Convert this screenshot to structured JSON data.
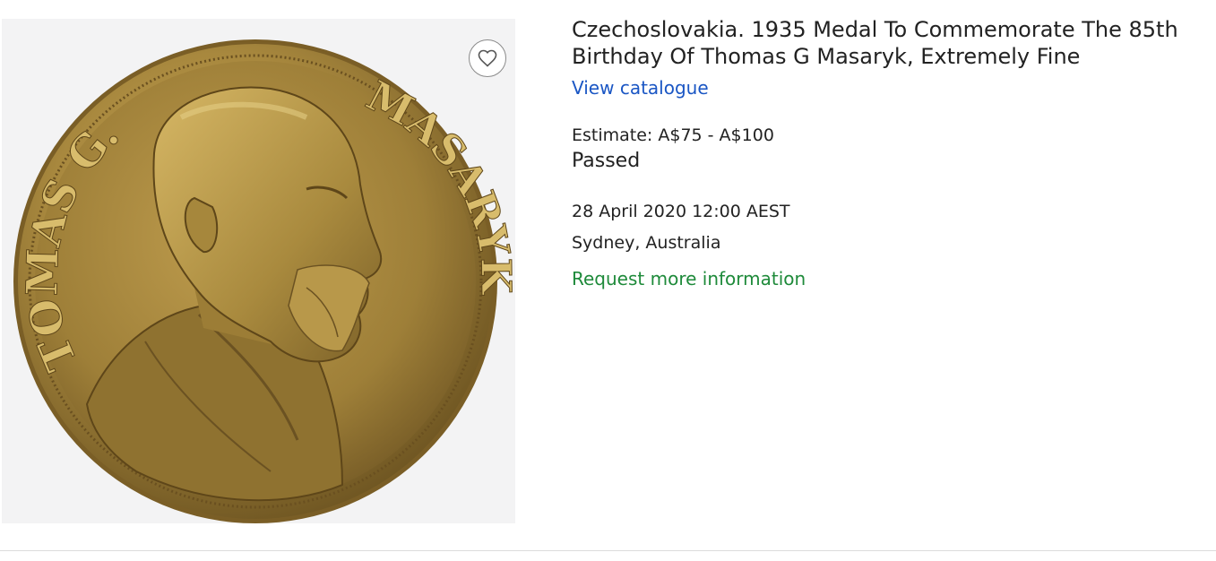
{
  "lot": {
    "title": "Czechoslovakia. 1935 Medal To Commemorate The 85th Birthday Of Thomas G Masaryk, Extremely Fine",
    "view_catalogue": "View catalogue",
    "estimate": "Estimate: A$75 - A$100",
    "status": "Passed",
    "date": "28 April 2020 12:00 AEST",
    "location": "Sydney, Australia",
    "request_info": "Request more information"
  },
  "image": {
    "medal_inscription_left": "TOMAS G.",
    "medal_inscription_right": "MASARYK",
    "favourite_icon": "heart-icon"
  },
  "colors": {
    "link_blue": "#1a56c4",
    "link_green": "#1e8a3a",
    "medal_bronze": "#a8883e"
  }
}
